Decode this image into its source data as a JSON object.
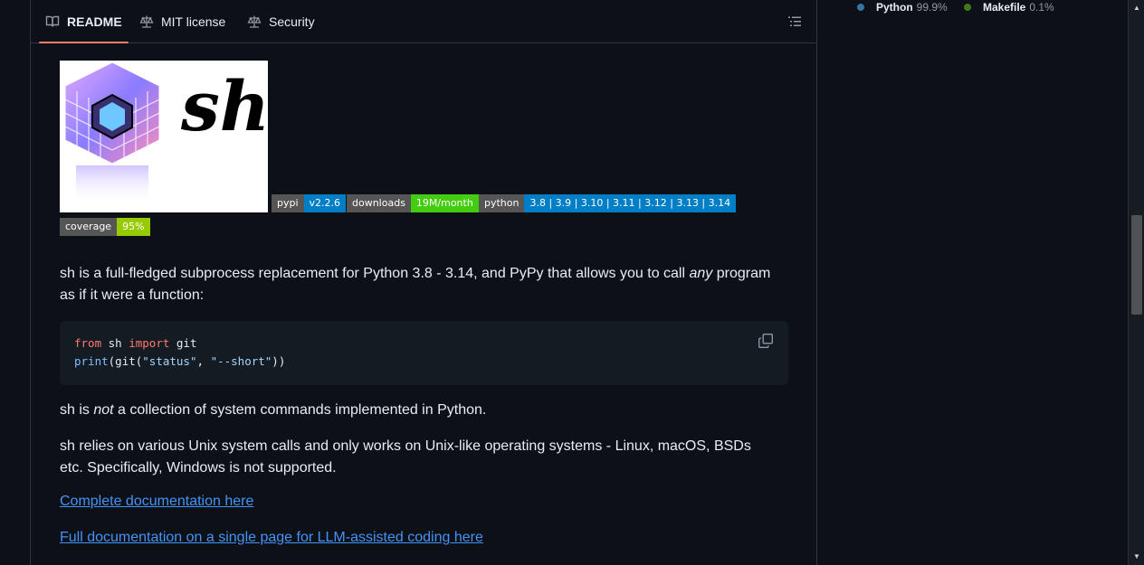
{
  "tabs": [
    {
      "label": "README",
      "icon": "book-icon",
      "active": true
    },
    {
      "label": "MIT license",
      "icon": "scale-icon",
      "active": false
    },
    {
      "label": "Security",
      "icon": "scale-icon",
      "active": false
    }
  ],
  "logo": {
    "text": "sh"
  },
  "badges": [
    {
      "label": "pypi",
      "value": "v2.2.6",
      "color": "#007ec6"
    },
    {
      "label": "downloads",
      "value": "19M/month",
      "color": "#4c1"
    },
    {
      "label": "python",
      "value": "3.8 | 3.9 | 3.10 | 3.11 | 3.12 | 3.13 | 3.14",
      "color": "#007ec6"
    },
    {
      "label": "coverage",
      "value": "95%",
      "color": "#97ca00"
    }
  ],
  "intro": {
    "part1": "sh is a full-fledged subprocess replacement for Python 3.8 - 3.14, and PyPy that allows you to call ",
    "emph": "any",
    "part2": " program as if it were a function:"
  },
  "code": {
    "line1": {
      "kw1": "from",
      "mod": " sh ",
      "kw2": "import",
      "name": " git"
    },
    "line2": {
      "fn": "print",
      "open": "(git(",
      "s1": "\"status\"",
      "comma": ", ",
      "s2": "\"--short\"",
      "close": "))"
    }
  },
  "not_para": {
    "part1": "sh is ",
    "emph": "not",
    "part2": " a collection of system commands implemented in Python."
  },
  "unix_para": "sh relies on various Unix system calls and only works on Unix-like operating systems - Linux, macOS, BSDs etc. Specifically, Windows is not supported.",
  "links": {
    "docs": "Complete documentation here",
    "llm_docs": "Full documentation on a single page for LLM-assisted coding here"
  },
  "languages": [
    {
      "name": "Python",
      "pct": "99.9%",
      "color": "#3572A5"
    },
    {
      "name": "Makefile",
      "pct": "0.1%",
      "color": "#427819"
    }
  ]
}
